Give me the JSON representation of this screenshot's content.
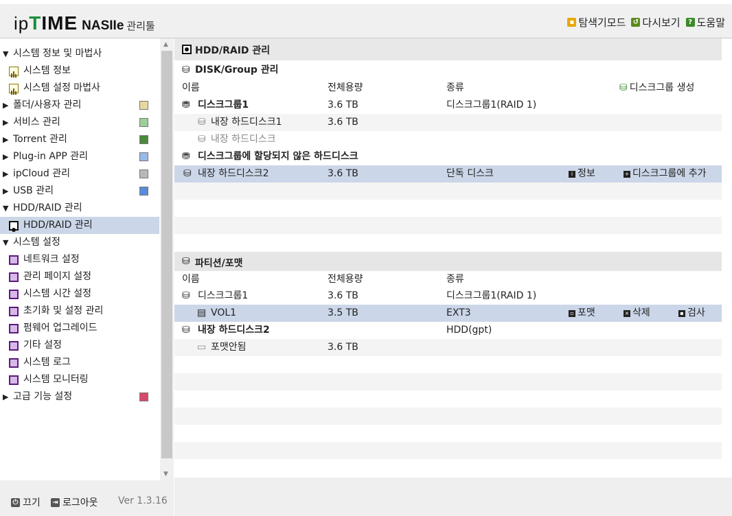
{
  "header": {
    "logo_ip": "ip",
    "logo_time": "TIME",
    "logo_model": "NASIIe",
    "logo_tool": "관리툴",
    "links": [
      {
        "label": "탐색기모드",
        "icon": "folder-icon",
        "color": "#e6a800"
      },
      {
        "label": "다시보기",
        "icon": "reload-icon",
        "color": "#5a8a1a"
      },
      {
        "label": "도움말",
        "icon": "help-icon",
        "color": "#3a8a2a"
      }
    ]
  },
  "sidebar": {
    "items": [
      {
        "label": "시스템 정보 및 마법사",
        "type": "group-open"
      },
      {
        "label": "시스템 정보",
        "type": "leaf",
        "icon": "chart-icon"
      },
      {
        "label": "시스템 설정 마법사",
        "type": "leaf",
        "icon": "chart-icon"
      },
      {
        "label": "폴더/사용자 관리",
        "type": "group",
        "right_icon": "folder-user-icon"
      },
      {
        "label": "서비스 관리",
        "type": "group",
        "right_icon": "service-icon"
      },
      {
        "label": "Torrent 관리",
        "type": "group",
        "right_icon": "torrent-icon"
      },
      {
        "label": "Plug-in APP 관리",
        "type": "group",
        "right_icon": "plugin-icon"
      },
      {
        "label": "ipCloud 관리",
        "type": "group",
        "right_icon": "cloud-icon"
      },
      {
        "label": "USB 관리",
        "type": "group",
        "right_icon": "usb-icon"
      },
      {
        "label": "HDD/RAID 관리",
        "type": "group-open"
      },
      {
        "label": "HDD/RAID 관리",
        "type": "leaf",
        "icon": "hdd-icon",
        "selected": true
      },
      {
        "label": "시스템 설정",
        "type": "group-open"
      },
      {
        "label": "네트워크 설정",
        "type": "leaf",
        "icon": "settings-icon"
      },
      {
        "label": "관리 페이지 설정",
        "type": "leaf",
        "icon": "settings-icon"
      },
      {
        "label": "시스템 시간 설정",
        "type": "leaf",
        "icon": "settings-icon"
      },
      {
        "label": "초기화 및 설정 관리",
        "type": "leaf",
        "icon": "settings-icon"
      },
      {
        "label": "펌웨어 업그레이드",
        "type": "leaf",
        "icon": "settings-icon"
      },
      {
        "label": "기타 설정",
        "type": "leaf",
        "icon": "settings-icon"
      },
      {
        "label": "시스템 로그",
        "type": "leaf",
        "icon": "settings-icon"
      },
      {
        "label": "시스템 모니터링",
        "type": "leaf",
        "icon": "settings-icon"
      },
      {
        "label": "고급 기능 설정",
        "type": "group",
        "right_icon": "advanced-icon"
      }
    ]
  },
  "footer": {
    "power_label": "끄기",
    "logout_label": "로그아웃",
    "version": "Ver 1.3.16"
  },
  "main": {
    "title": "HDD/RAID 관리",
    "disk_section": {
      "title": "DISK/Group 관리",
      "col_name": "이름",
      "col_capacity": "전체용량",
      "col_type": "종류",
      "create_group_label": "디스크그룹 생성",
      "group1_name": "디스크그룹1",
      "group1_capacity": "3.6 TB",
      "group1_type": "디스크그룹1(RAID 1)",
      "disk1_name": "내장 하드디스크1",
      "disk1_capacity": "3.6 TB",
      "disk_empty_name": "내장 하드디스크",
      "unassigned_label": "디스크그룹에 할당되지 않은 하드디스크",
      "disk2_name": "내장 하드디스크2",
      "disk2_capacity": "3.6 TB",
      "disk2_type": "단독 디스크",
      "info_label": "정보",
      "add_to_group_label": "디스크그룹에 추가"
    },
    "partition_section": {
      "title": "파티션/포맷",
      "col_name": "이름",
      "col_capacity": "전체용량",
      "col_type": "종류",
      "group1_name": "디스크그룹1",
      "group1_capacity": "3.6 TB",
      "group1_type": "디스크그룹1(RAID 1)",
      "vol_name": "VOL1",
      "vol_capacity": "3.5 TB",
      "vol_type": "EXT3",
      "format_label": "포맷",
      "delete_label": "삭제",
      "check_label": "검사",
      "disk2_name": "내장 하드디스크2",
      "disk2_type": "HDD(gpt)",
      "unformatted_name": "포맷안됨",
      "unformatted_capacity": "3.6 TB"
    }
  }
}
